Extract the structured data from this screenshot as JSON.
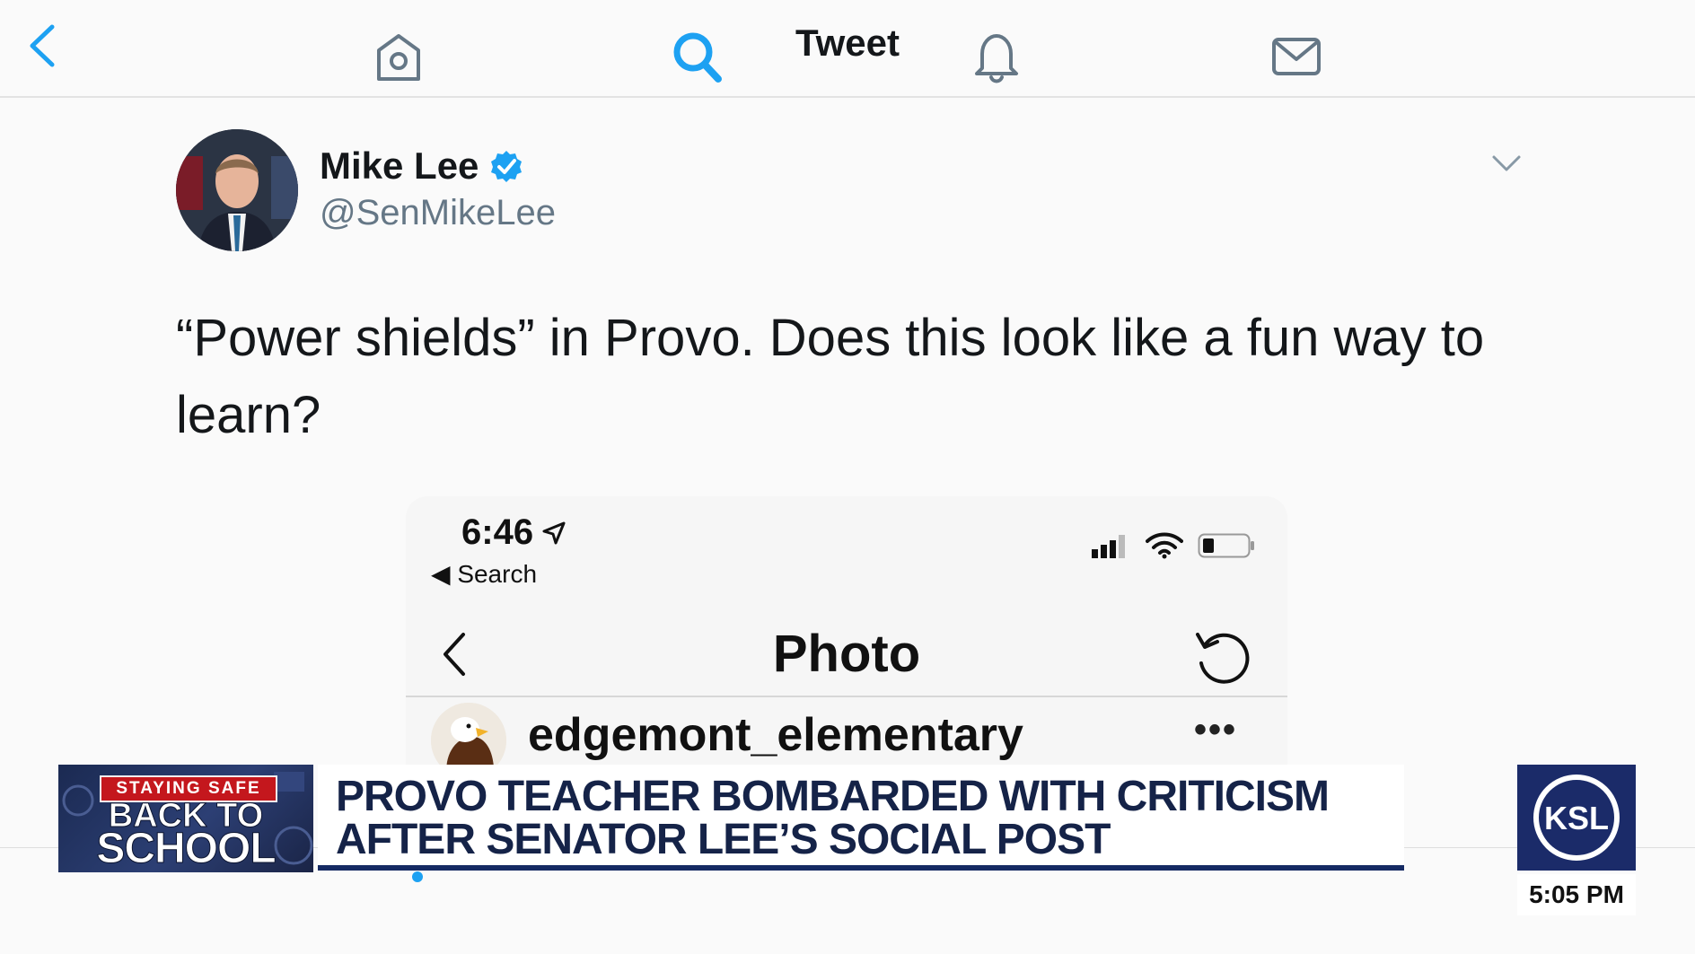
{
  "header": {
    "title": "Tweet"
  },
  "tweet": {
    "author_name": "Mike Lee",
    "author_handle": "@SenMikeLee",
    "text": "“Power shields” in Provo.  Does this look like a fun way to learn?"
  },
  "embedded_screenshot": {
    "time": "6:46",
    "back_label": "Search",
    "nav_title": "Photo",
    "post_user": "edgemont_elementary",
    "more_label": "•••"
  },
  "tabbar": {
    "tabs": [
      "home",
      "search",
      "notifications",
      "messages"
    ],
    "active": "search"
  },
  "lower_third": {
    "badge_top": "STAYING SAFE",
    "badge_mid": "BACK TO",
    "badge_bottom": "SCHOOL",
    "headline_line1": "PROVO TEACHER BOMBARDED WITH CRITICISM",
    "headline_line2": "AFTER SENATOR LEE’S SOCIAL POST",
    "station_logo": "KSL",
    "time": "5:05 PM"
  },
  "colors": {
    "accent": "#1da1f2",
    "text_primary": "#14171a",
    "text_secondary": "#657786",
    "lower_third_navy": "#152348",
    "badge_red": "#c4171d",
    "ksl_blue": "#1b2b69"
  },
  "icons": [
    "back-chevron-icon",
    "verified-badge-icon",
    "chevron-down-icon",
    "location-arrow-icon",
    "signal-icon",
    "wifi-icon",
    "battery-icon",
    "refresh-icon",
    "home-icon",
    "search-icon",
    "bell-icon",
    "mail-icon"
  ]
}
